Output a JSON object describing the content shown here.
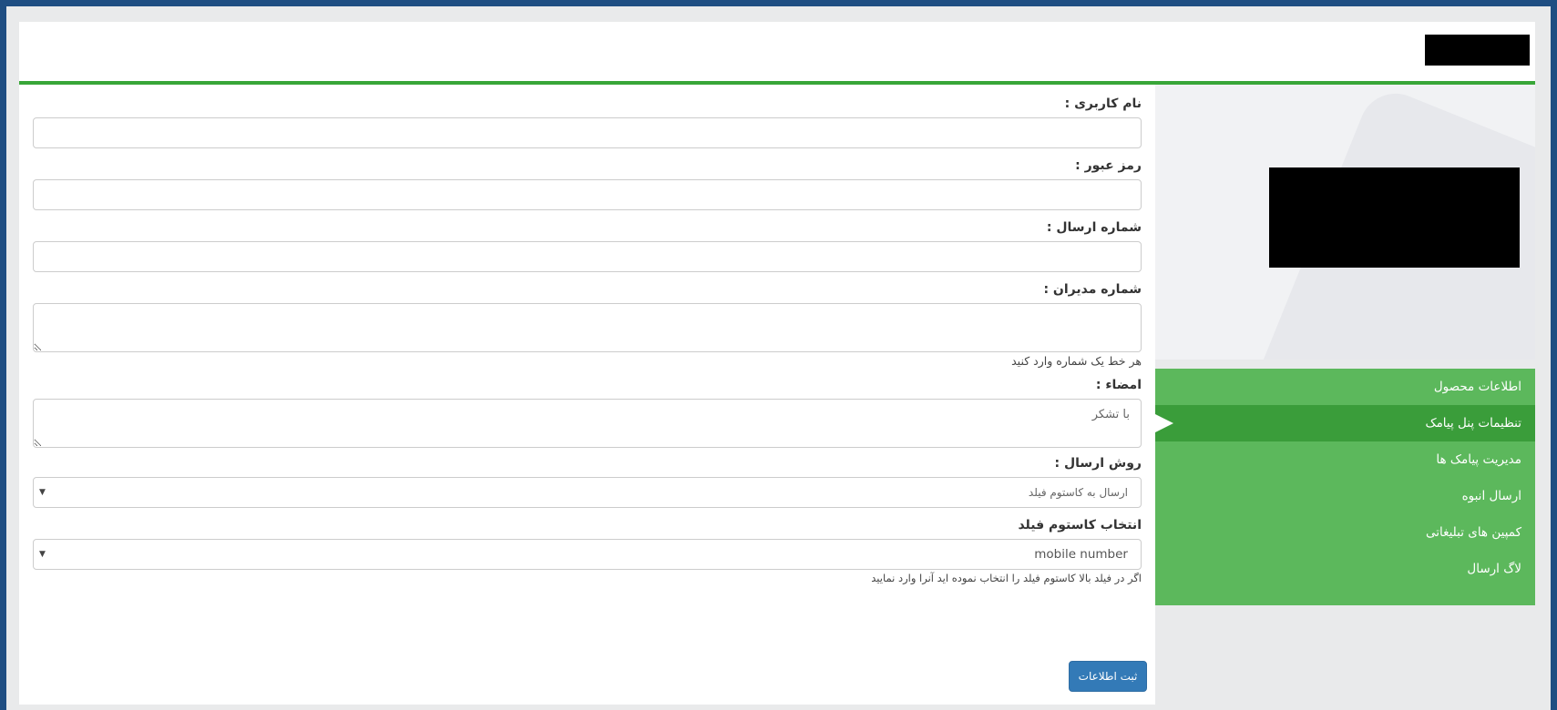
{
  "form": {
    "username_label": "نام کاربری :",
    "username_value": "",
    "password_label": "رمز عبور :",
    "password_value": "",
    "sender_number_label": "شماره ارسال :",
    "sender_number_value": "",
    "admin_numbers_label": "شماره مدیران :",
    "admin_numbers_value": "",
    "admin_numbers_help": "هر خط یک شماره وارد کنید",
    "signature_label": "امضاء :",
    "signature_value": "با تشکر",
    "send_method_label": "روش ارسال :",
    "send_method_selected": "ارسال به کاستوم فیلد",
    "custom_field_label": "انتخاب کاستوم فیلد",
    "custom_field_selected": "mobile number",
    "custom_field_help": "اگر در فیلد بالا کاستوم فیلد را انتخاب نموده اید آنرا وارد نمایید",
    "submit_label": "ثبت اطلاعات"
  },
  "sidebar": {
    "items": [
      {
        "label": "اطلاعات محصول",
        "active": false
      },
      {
        "label": "تنظیمات پنل پیامک",
        "active": true
      },
      {
        "label": "مدیریت پیامک ها",
        "active": false
      },
      {
        "label": "ارسال انبوه",
        "active": false
      },
      {
        "label": "کمپین های تبلیغاتی",
        "active": false
      },
      {
        "label": "لاگ ارسال",
        "active": false
      }
    ]
  },
  "colors": {
    "accent_green": "#38a638",
    "menu_green": "#5cb85c",
    "menu_active": "#3a9d3a",
    "button_blue": "#337ab7",
    "outer_blue": "#1f4e82"
  },
  "icons": {
    "select_arrow": "caret-down-icon"
  }
}
